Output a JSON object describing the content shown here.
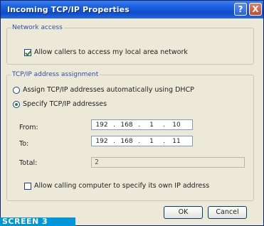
{
  "window": {
    "title": "Incoming TCP/IP Properties",
    "help_glyph": "?",
    "close_glyph": "X"
  },
  "network_access": {
    "legend": "Network access",
    "allow_label": "Allow callers to access my local area network",
    "allow_checked": true
  },
  "tcpip": {
    "legend": "TCP/IP address assignment",
    "dhcp_label": "Assign TCP/IP addresses automatically using DHCP",
    "specify_label": "Specify TCP/IP addresses",
    "selected": "specify",
    "from_label": "From:",
    "to_label": "To:",
    "total_label": "Total:",
    "from_octets": [
      "192",
      "168",
      "1",
      "10"
    ],
    "to_octets": [
      "192",
      "168",
      "1",
      "11"
    ],
    "total_value": "2",
    "allow_own_ip_label": "Allow calling computer to specify its own IP address",
    "allow_own_ip_checked": false
  },
  "buttons": {
    "ok": "OK",
    "cancel": "Cancel"
  },
  "overlay": {
    "screen_label": "SCREEN 3"
  }
}
